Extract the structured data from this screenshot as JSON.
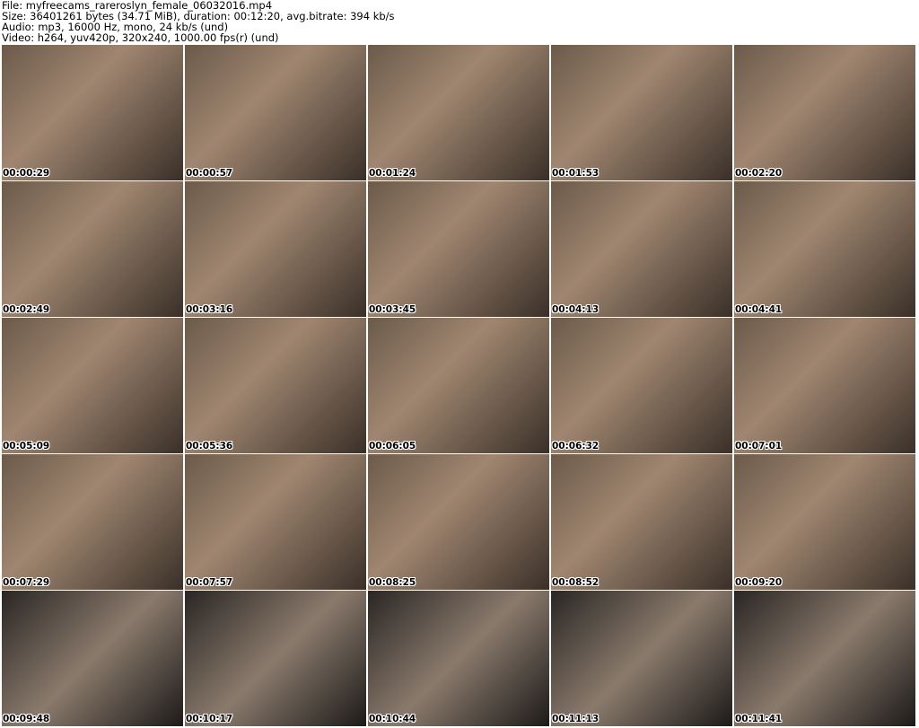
{
  "header": {
    "file": "File: myfreecams_rareroslyn_female_06032016.mp4",
    "size": "Size: 36401261 bytes (34.71 MiB), duration: 00:12:20, avg.bitrate: 394 kb/s",
    "audio": "Audio: mp3, 16000 Hz, mono, 24 kb/s (und)",
    "video": "Video: h264, yuv420p, 320x240, 1000.00 fps(r) (und)"
  },
  "timestamps": [
    "00:00:29",
    "00:00:57",
    "00:01:24",
    "00:01:53",
    "00:02:20",
    "00:02:49",
    "00:03:16",
    "00:03:45",
    "00:04:13",
    "00:04:41",
    "00:05:09",
    "00:05:36",
    "00:06:05",
    "00:06:32",
    "00:07:01",
    "00:07:29",
    "00:07:57",
    "00:08:25",
    "00:08:52",
    "00:09:20",
    "00:09:48",
    "00:10:17",
    "00:10:44",
    "00:11:13",
    "00:11:41"
  ]
}
